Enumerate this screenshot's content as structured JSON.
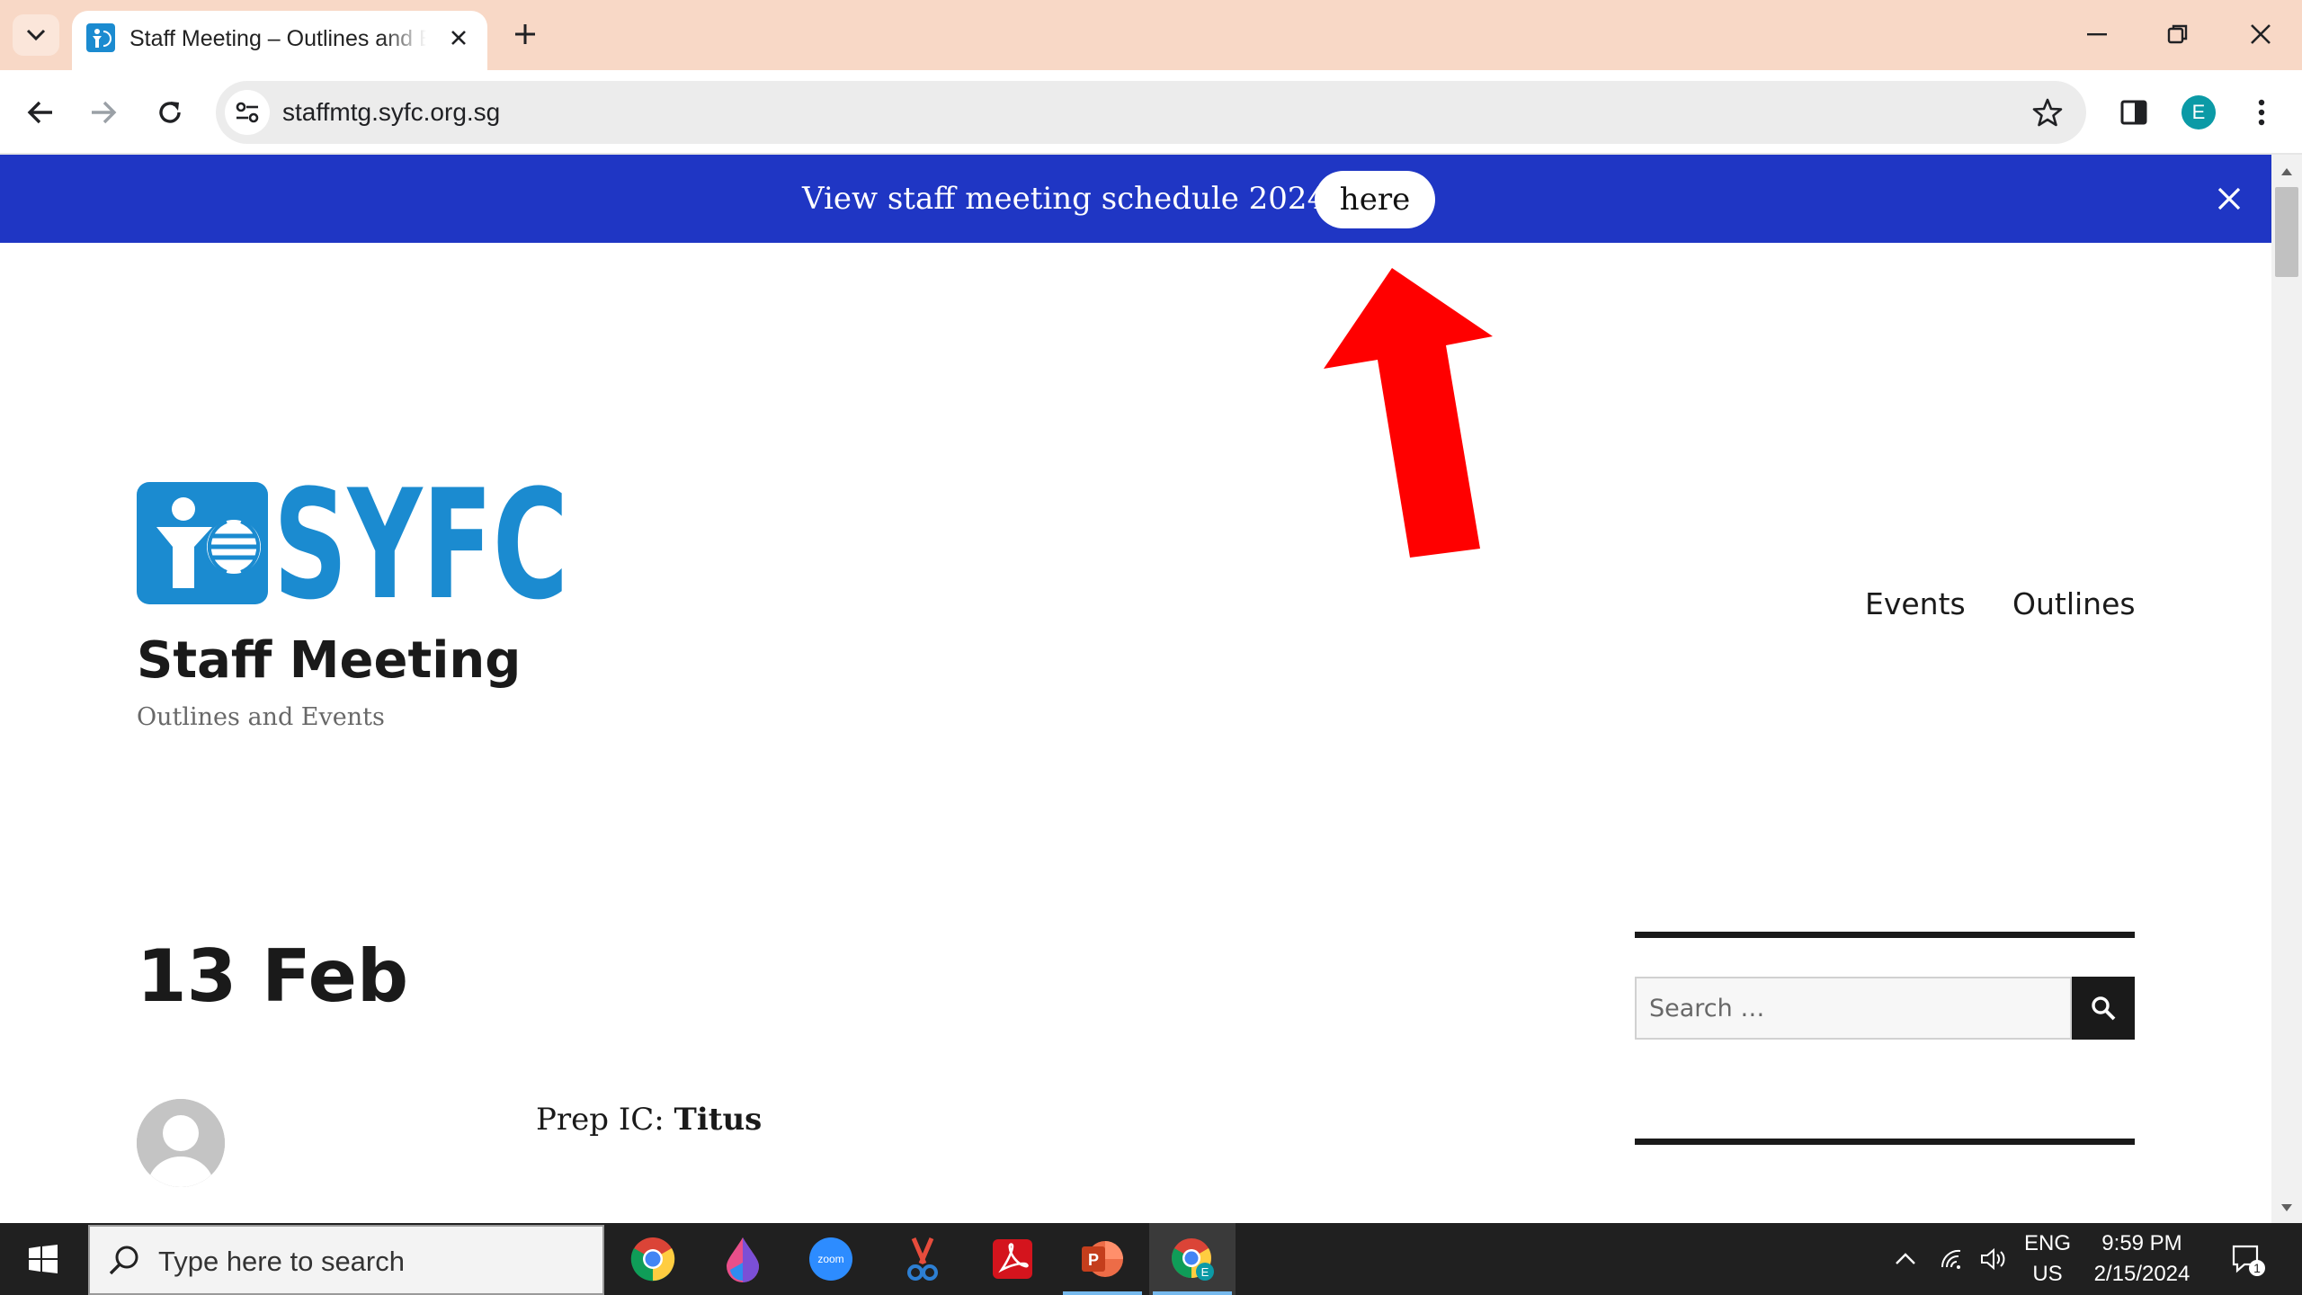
{
  "browser": {
    "tab": {
      "title": "Staff Meeting – Outlines and Events"
    },
    "url": "staffmtg.syfc.org.sg",
    "profile_initial": "E"
  },
  "announcement": {
    "text": "View staff meeting schedule 2024",
    "button_label": "here"
  },
  "site": {
    "logo_text": "SYFC",
    "title": "Staff Meeting",
    "description": "Outlines and Events",
    "nav": [
      {
        "label": "Events"
      },
      {
        "label": "Outlines"
      }
    ]
  },
  "post": {
    "title": "13 Feb",
    "meta_prefix": "Prep IC: ",
    "meta_name": "Titus"
  },
  "sidebar": {
    "search_placeholder": "Search …"
  },
  "taskbar": {
    "search_placeholder": "Type here to search",
    "apps": [
      "chrome-icon",
      "drop-icon",
      "zoom-icon",
      "snipping-tool-icon",
      "acrobat-icon",
      "powerpoint-icon",
      "chrome-profile-icon"
    ],
    "zoom_label": "zoom",
    "language": "ENG",
    "region": "US",
    "time": "9:59 PM",
    "date": "2/15/2024",
    "notification_count": "1"
  },
  "colors": {
    "announcement_bg": "#1f36c4",
    "brand_blue": "#1b8bd0",
    "arrow_red": "#ff0000",
    "tabbar_bg": "#f8d8c6",
    "taskbar_bg": "#202020"
  }
}
